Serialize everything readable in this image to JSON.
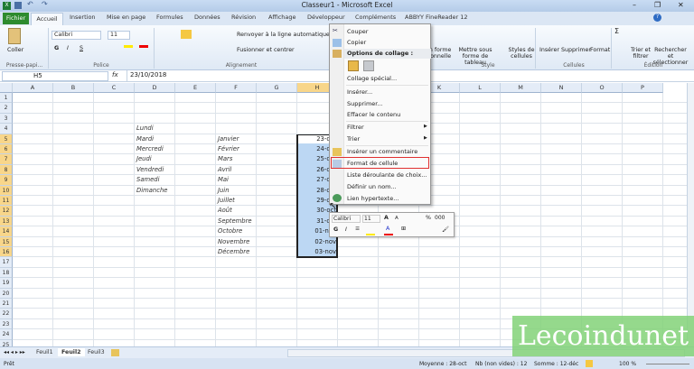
{
  "window": {
    "title": "Classeur1 - Microsoft Excel"
  },
  "tabs": [
    "Fichier",
    "Accueil",
    "Insertion",
    "Mise en page",
    "Formules",
    "Données",
    "Révision",
    "Affichage",
    "Développeur",
    "Compléments",
    "ABBYY FineReader 12"
  ],
  "ribbon": {
    "paste": "Coller",
    "clipboard_group": "Presse-papi...",
    "font": "Calibri",
    "size": "11",
    "bold": "G",
    "italic": "I",
    "underline": "S",
    "font_group": "Police",
    "wrap": "Renvoyer à la ligne automatiquement",
    "merge": "Fusionner et centrer",
    "align_group": "Alignement",
    "cond": "Mise en forme conditionnelle",
    "table": "Mettre sous forme de tableau",
    "styles": "Styles de cellules",
    "style_group": "Style",
    "insert": "Insérer",
    "delete": "Supprimer",
    "format": "Format",
    "cells_group": "Cellules",
    "sort": "Trier et filtrer",
    "find": "Rechercher et sélectionner",
    "edit_group": "Édition"
  },
  "formula_bar": {
    "name_box": "H5",
    "fx": "fx",
    "value": "23/10/2018"
  },
  "columns": [
    "A",
    "B",
    "C",
    "D",
    "E",
    "F",
    "G",
    "H",
    "I",
    "J",
    "K",
    "L",
    "M",
    "N",
    "O",
    "P"
  ],
  "rows": [
    "1",
    "2",
    "3",
    "4",
    "5",
    "6",
    "7",
    "8",
    "9",
    "10",
    "11",
    "12",
    "13",
    "14",
    "15",
    "16",
    "17",
    "18",
    "19",
    "20",
    "21",
    "22",
    "23",
    "24",
    "25",
    "26"
  ],
  "col_d": [
    "Lundi",
    "Mardi",
    "Mercredi",
    "Jeudi",
    "Vendredi",
    "Samedi",
    "Dimanche"
  ],
  "col_f": [
    "Janvier",
    "Février",
    "Mars",
    "Avril",
    "Mai",
    "Juin",
    "Juillet",
    "Août",
    "Septembre",
    "Octobre",
    "Novembre",
    "Décembre"
  ],
  "col_h": [
    "23-oct",
    "24-oct",
    "25-oct",
    "26-oct",
    "27-oct",
    "28-oct",
    "29-oct",
    "30-oct",
    "31-oct",
    "01-nov",
    "02-nov",
    "03-nov"
  ],
  "context_menu": {
    "cut": "Couper",
    "copy": "Copier",
    "paste_options": "Options de collage :",
    "paste_special": "Collage spécial...",
    "insert": "Insérer...",
    "delete": "Supprimer...",
    "clear": "Effacer le contenu",
    "filter": "Filtrer",
    "sort": "Trier",
    "comment": "Insérer un commentaire",
    "format_cells": "Format de cellule",
    "dropdown": "Liste déroulante de choix...",
    "define_name": "Définir un nom...",
    "hyperlink": "Lien hypertexte..."
  },
  "mini_toolbar": {
    "font": "Calibri",
    "size": "11",
    "bold": "G",
    "italic": "I",
    "percent": "%",
    "thousands": "000"
  },
  "sheets": [
    "Feuil1",
    "Feuil2",
    "Feuil3"
  ],
  "active_sheet": "Feuil2",
  "status": {
    "ready": "Prêt",
    "average": "Moyenne : 28-oct",
    "count": "Nb (non vides) : 12",
    "sum": "Somme : 12-déc",
    "zoom": "100 %"
  },
  "watermark": "Lecoindunet",
  "colors": {
    "file_tab": "#2e8b2e",
    "selection": "#bcd7f3",
    "highlight": "#e03030"
  }
}
